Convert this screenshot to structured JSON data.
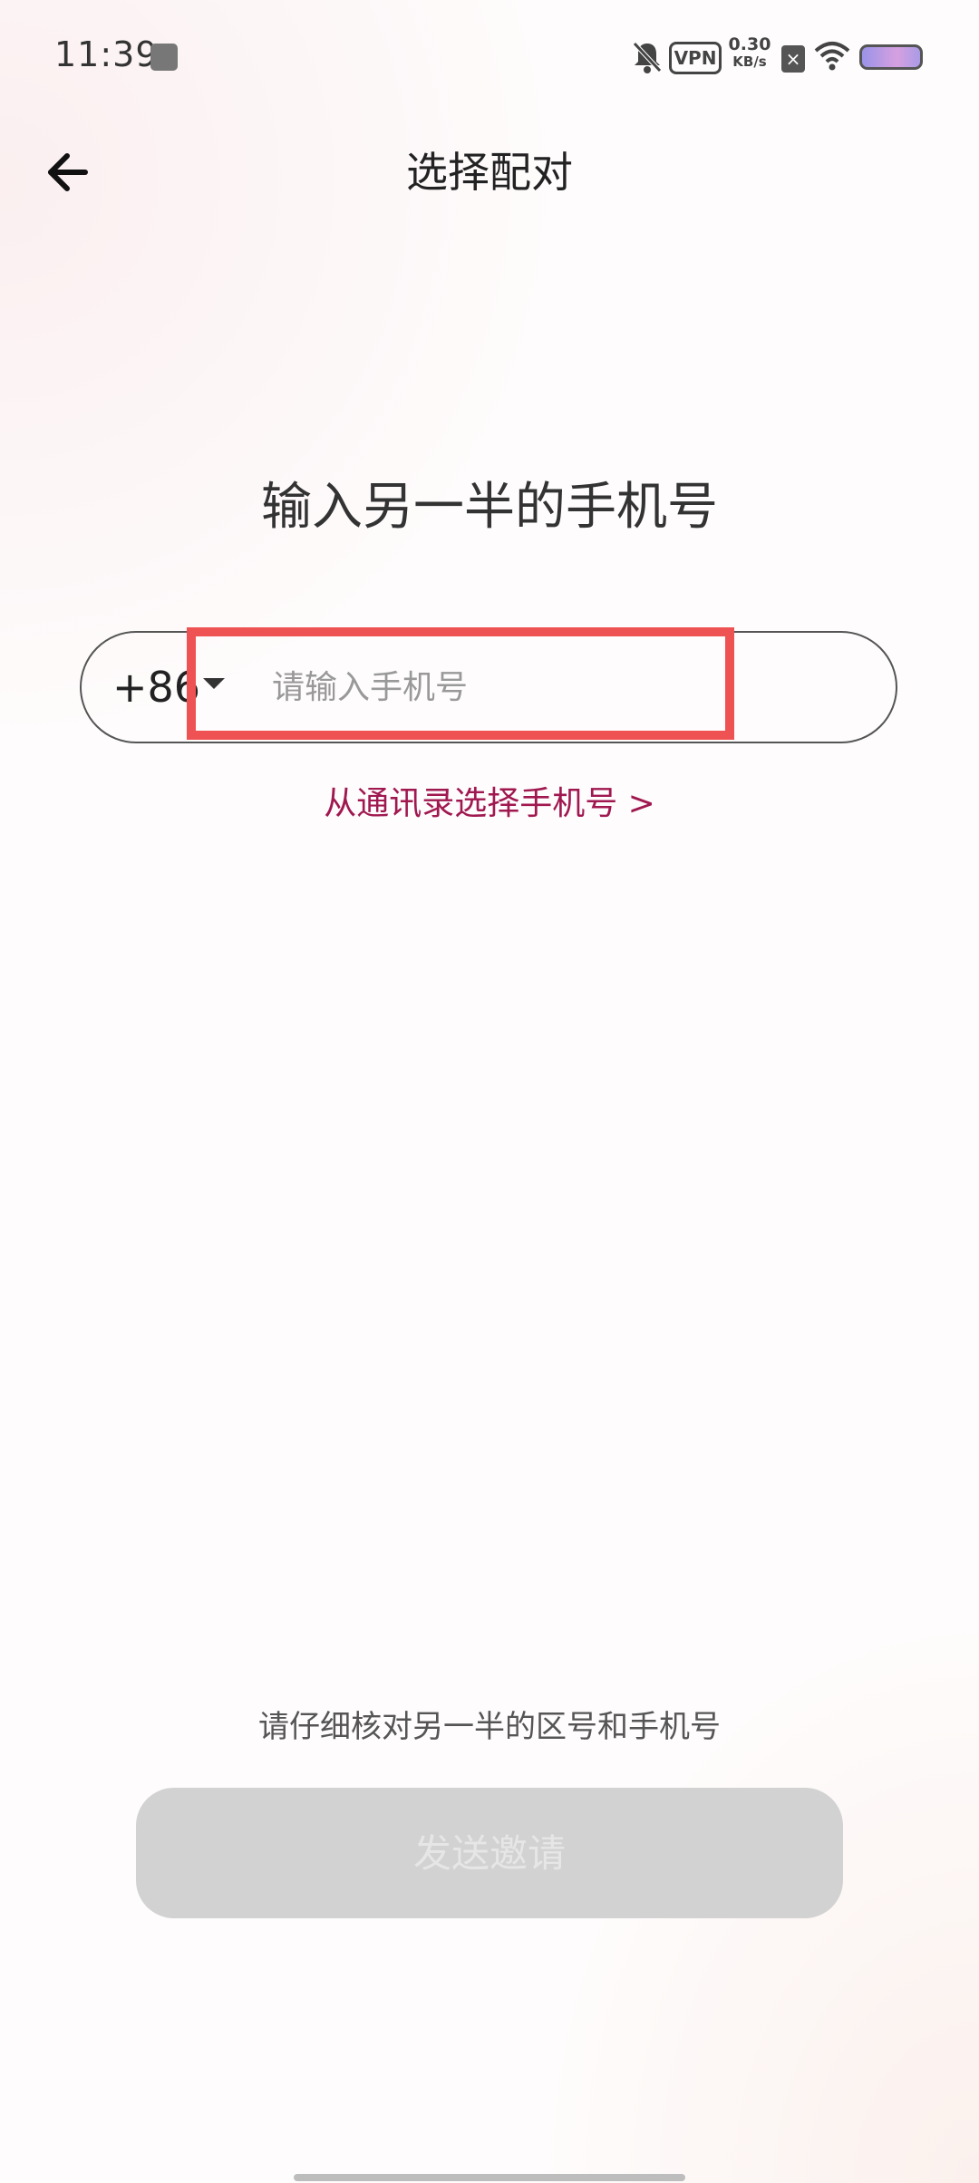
{
  "status_bar": {
    "time": "11:39",
    "vpn_label": "VPN",
    "net_speed_value": "0.30",
    "net_speed_unit": "KB/s",
    "icons": [
      "gallery-icon",
      "mute-bell-icon",
      "vpn-icon",
      "sim-off-icon",
      "wifi-icon",
      "battery-icon"
    ]
  },
  "header": {
    "title": "选择配对",
    "back_icon": "arrow-left-icon"
  },
  "main": {
    "prompt": "输入另一半的手机号",
    "country_code": "+86",
    "country_caret_icon": "caret-down-icon",
    "phone_placeholder": "请输入手机号",
    "phone_value": "",
    "contacts_link": "从通讯录选择手机号 >"
  },
  "footer": {
    "hint": "请仔细核对另一半的区号和手机号",
    "send_button": "发送邀请"
  },
  "colors": {
    "accent_link": "#a01850",
    "highlight": "#ee5252",
    "button_disabled_bg": "#d2d2d2",
    "button_disabled_text": "#e6e6e6"
  }
}
